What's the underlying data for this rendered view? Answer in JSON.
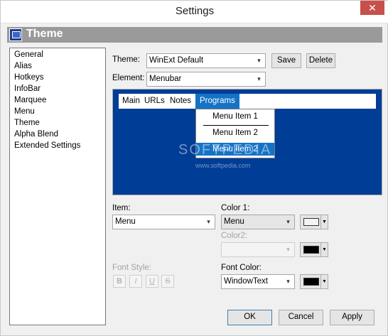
{
  "window": {
    "title": "Settings",
    "close_glyph": "✕"
  },
  "header": {
    "title": "Theme",
    "logo_icon": "winext-logo-icon"
  },
  "tree": {
    "items": [
      {
        "label": "General"
      },
      {
        "label": "Alias"
      },
      {
        "label": "Hotkeys"
      },
      {
        "label": "InfoBar"
      },
      {
        "label": "Marquee"
      },
      {
        "label": "Menu"
      },
      {
        "label": "Theme"
      },
      {
        "label": "Alpha Blend"
      },
      {
        "label": "Extended Settings"
      }
    ]
  },
  "theme": {
    "label": "Theme:",
    "value": "WinExt Default",
    "save_label": "Save",
    "delete_label": "Delete"
  },
  "element": {
    "label": "Element:",
    "value": "Menubar"
  },
  "preview": {
    "background": "#003d96",
    "menubar": [
      {
        "label": "Main"
      },
      {
        "label": "URLs"
      },
      {
        "label": "Notes"
      },
      {
        "label": "Programs"
      }
    ],
    "popup": [
      {
        "label": "Menu Item 1"
      },
      {
        "label": "Menu Item 2"
      },
      {
        "label": "Menu Item 2"
      }
    ],
    "watermark": "SOFTPEDIA",
    "watermark_url": "www.softpedia.com"
  },
  "item": {
    "label": "Item:",
    "value": "Menu"
  },
  "color1": {
    "label": "Color 1:",
    "value": "Menu",
    "swatch": "#f4f4f4"
  },
  "color2": {
    "label": "Color2:",
    "value": "",
    "swatch": "#000000"
  },
  "font_style": {
    "label": "Font Style:",
    "bold": "B",
    "italic": "I",
    "underline": "U",
    "strike": "S"
  },
  "font_color": {
    "label": "Font Color:",
    "value": "WindowText",
    "swatch": "#000000"
  },
  "footer": {
    "ok_label": "OK",
    "cancel_label": "Cancel",
    "apply_label": "Apply"
  },
  "icons": {
    "dropdown": "▾",
    "color_dropdown": "▼"
  }
}
